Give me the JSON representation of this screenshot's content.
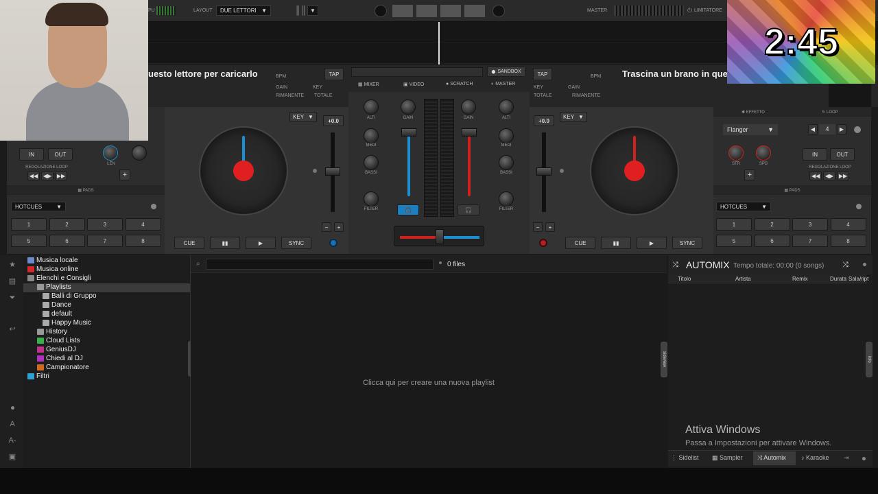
{
  "topbar": {
    "pu": "PU",
    "layout_label": "LAYOUT",
    "layout_value": "DUE LETTORI",
    "master_label": "MASTER",
    "limiter_label": "LIMITATORE"
  },
  "timer": "2:45",
  "decks": {
    "left": {
      "title": "uesto lettore per caricarlo",
      "bpm": "BPM",
      "gain": "GAIN",
      "key": "KEY",
      "remaining": "RIMANENTE",
      "total": "TOTALE",
      "tap": "TAP",
      "key_btn": "KEY",
      "pitch": "+0.0",
      "in": "IN",
      "out": "OUT",
      "loop_reg": "REGOLAZIONE LOOP",
      "len": "LEN",
      "pads_label": "PADS",
      "hotcues": "HOTCUES",
      "pads": [
        "1",
        "2",
        "3",
        "4",
        "5",
        "6",
        "7",
        "8"
      ],
      "cue": "CUE",
      "play_pause": "▮▮",
      "play": "▶",
      "sync": "SYNC"
    },
    "right": {
      "title": "Trascina un brano in que",
      "bpm": "BPM",
      "gain": "GAIN",
      "key": "KEY",
      "remaining": "RIMANENTE",
      "total": "TOTALE",
      "tap": "TAP",
      "key_btn": "KEY",
      "pitch": "+0.0",
      "effect_label": "EFFETTO",
      "loop_label": "LOOP",
      "effect_value": "Flanger",
      "loop_value": "4",
      "str": "STR",
      "spd": "SPD",
      "in": "IN",
      "out": "OUT",
      "loop_reg": "REGOLAZIONE LOOP",
      "pads_label": "PADS",
      "hotcues": "HOTCUES",
      "pads": [
        "1",
        "2",
        "3",
        "4",
        "5",
        "6",
        "7",
        "8"
      ],
      "cue": "CUE",
      "play_pause": "▮▮",
      "play": "▶",
      "sync": "SYNC"
    }
  },
  "mixer": {
    "sandbox": "SANDBOX",
    "tabs": [
      "MIXER",
      "VIDEO",
      "SCRATCH",
      "MASTER"
    ],
    "alti": "ALTI",
    "medi": "MEDI",
    "bassi": "BASSI",
    "filter": "FILTER",
    "gain": "GAIN"
  },
  "browser": {
    "tree": [
      {
        "label": "Musica locale",
        "indent": 0,
        "color": "#6a8ccc"
      },
      {
        "label": "Musica online",
        "indent": 0,
        "color": "#d02a2a"
      },
      {
        "label": "Elenchi e Consigli",
        "indent": 0,
        "color": "#888888"
      },
      {
        "label": "Playlists",
        "indent": 1,
        "color": "#999999"
      },
      {
        "label": "Balli di Gruppo",
        "indent": 2,
        "color": "#aaaaaa"
      },
      {
        "label": "Dance",
        "indent": 2,
        "color": "#aaaaaa"
      },
      {
        "label": "default",
        "indent": 2,
        "color": "#aaaaaa"
      },
      {
        "label": "Happy Music",
        "indent": 2,
        "color": "#aaaaaa"
      },
      {
        "label": "History",
        "indent": 1,
        "color": "#999999"
      },
      {
        "label": "Cloud Lists",
        "indent": 1,
        "color": "#3cae4a"
      },
      {
        "label": "GeniusDJ",
        "indent": 1,
        "color": "#c0308a"
      },
      {
        "label": "Chiedi al DJ",
        "indent": 1,
        "color": "#b030c0"
      },
      {
        "label": "Campionatore",
        "indent": 1,
        "color": "#d06a20"
      },
      {
        "label": "Filtri",
        "indent": 0,
        "color": "#30a0d0"
      }
    ],
    "search_placeholder": "",
    "files_count": "0 files",
    "empty_msg": "Clicca qui per creare una nuova playlist",
    "folders_tab": "folders",
    "sideview_tab": "sideview"
  },
  "automix": {
    "title": "AUTOMIX",
    "subtitle": "Tempo totale: 00:00 (0 songs)",
    "columns": [
      "Titolo",
      "Artista",
      "Remix",
      "Durata",
      "Sala/ript"
    ],
    "info_tab": "info"
  },
  "watermark": {
    "line1": "Attiva Windows",
    "line2": "Passa a Impostazioni per attivare Windows."
  },
  "bottom_tabs": [
    "Sidelist",
    "Sampler",
    "Automix",
    "Karaoke"
  ],
  "sidebar_letters": [
    "A",
    "A-"
  ]
}
